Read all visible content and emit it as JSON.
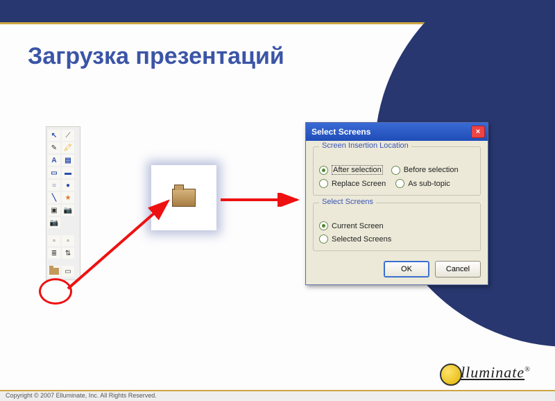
{
  "title": "Загрузка презентаций",
  "dialog": {
    "title": "Select Screens",
    "group1": {
      "legend": "Screen Insertion Location",
      "opt_after": "After selection",
      "opt_before": "Before selection",
      "opt_replace": "Replace Screen",
      "opt_sub": "As sub-topic"
    },
    "group2": {
      "legend": "Select Screens",
      "opt_current": "Current Screen",
      "opt_selected": "Selected Screens"
    },
    "ok": "OK",
    "cancel": "Cancel"
  },
  "toolbar_icons": {
    "pointer": "↖",
    "line_tool": "⟋",
    "highlighter": "🖍",
    "pen": "✎",
    "text": "A",
    "textbox": "▤",
    "rect_outline": "▭",
    "rect_fill": "▬",
    "oval_outline": "○",
    "oval_fill": "●",
    "line": "╲",
    "star": "★",
    "camera": "▣",
    "camera2": "📷",
    "blank1": "▫",
    "blank2": "▫",
    "page1": "≣",
    "page2": "⇅",
    "doc": "▭"
  },
  "footer": {
    "copyright": "Copyright © 2007 Elluminate, Inc. All Rights Reserved.",
    "logo_text": "lluminate"
  }
}
